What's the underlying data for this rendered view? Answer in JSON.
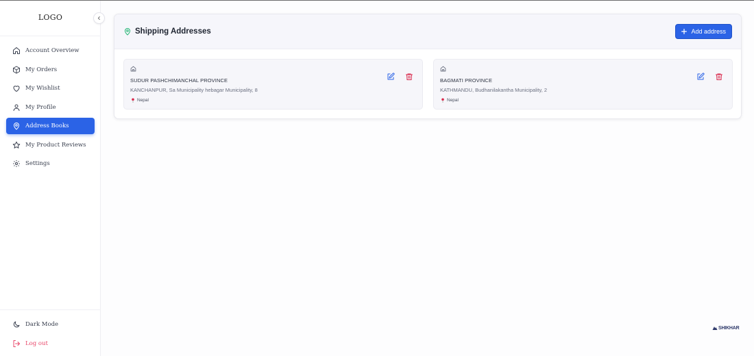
{
  "sidebar": {
    "logo": "LOGO",
    "items": [
      {
        "label": "Account Overview",
        "icon": "home-icon"
      },
      {
        "label": "My Orders",
        "icon": "box-icon"
      },
      {
        "label": "My Wishlist",
        "icon": "heart-icon"
      },
      {
        "label": "My Profile",
        "icon": "user-icon"
      },
      {
        "label": "Address Books",
        "icon": "map-pin-icon",
        "active": true
      },
      {
        "label": "My Product Reviews",
        "icon": "star-icon"
      },
      {
        "label": "Settings",
        "icon": "gear-icon"
      }
    ],
    "bottom": [
      {
        "label": "Dark Mode",
        "icon": "moon-icon"
      },
      {
        "label": "Log out",
        "icon": "logout-icon"
      }
    ]
  },
  "main": {
    "title": "Shipping Addresses",
    "add_button": "Add address",
    "addresses": [
      {
        "province": "SUDUR PASHCHIMANCHAL PROVINCE",
        "line": "KANCHANPUR, Sa Municipality hebagar Municipality, 8",
        "country": "Nepal"
      },
      {
        "province": "BAGMATI PROVINCE",
        "line": "KATHMANDU, Budhanilakantha Municipality, 2",
        "country": "Nepal"
      }
    ]
  },
  "brand": "SHIKHAR",
  "colors": {
    "accent": "#2b63e6",
    "danger": "#d8284b",
    "logout": "#e8476a",
    "title_icon": "#22b573"
  }
}
